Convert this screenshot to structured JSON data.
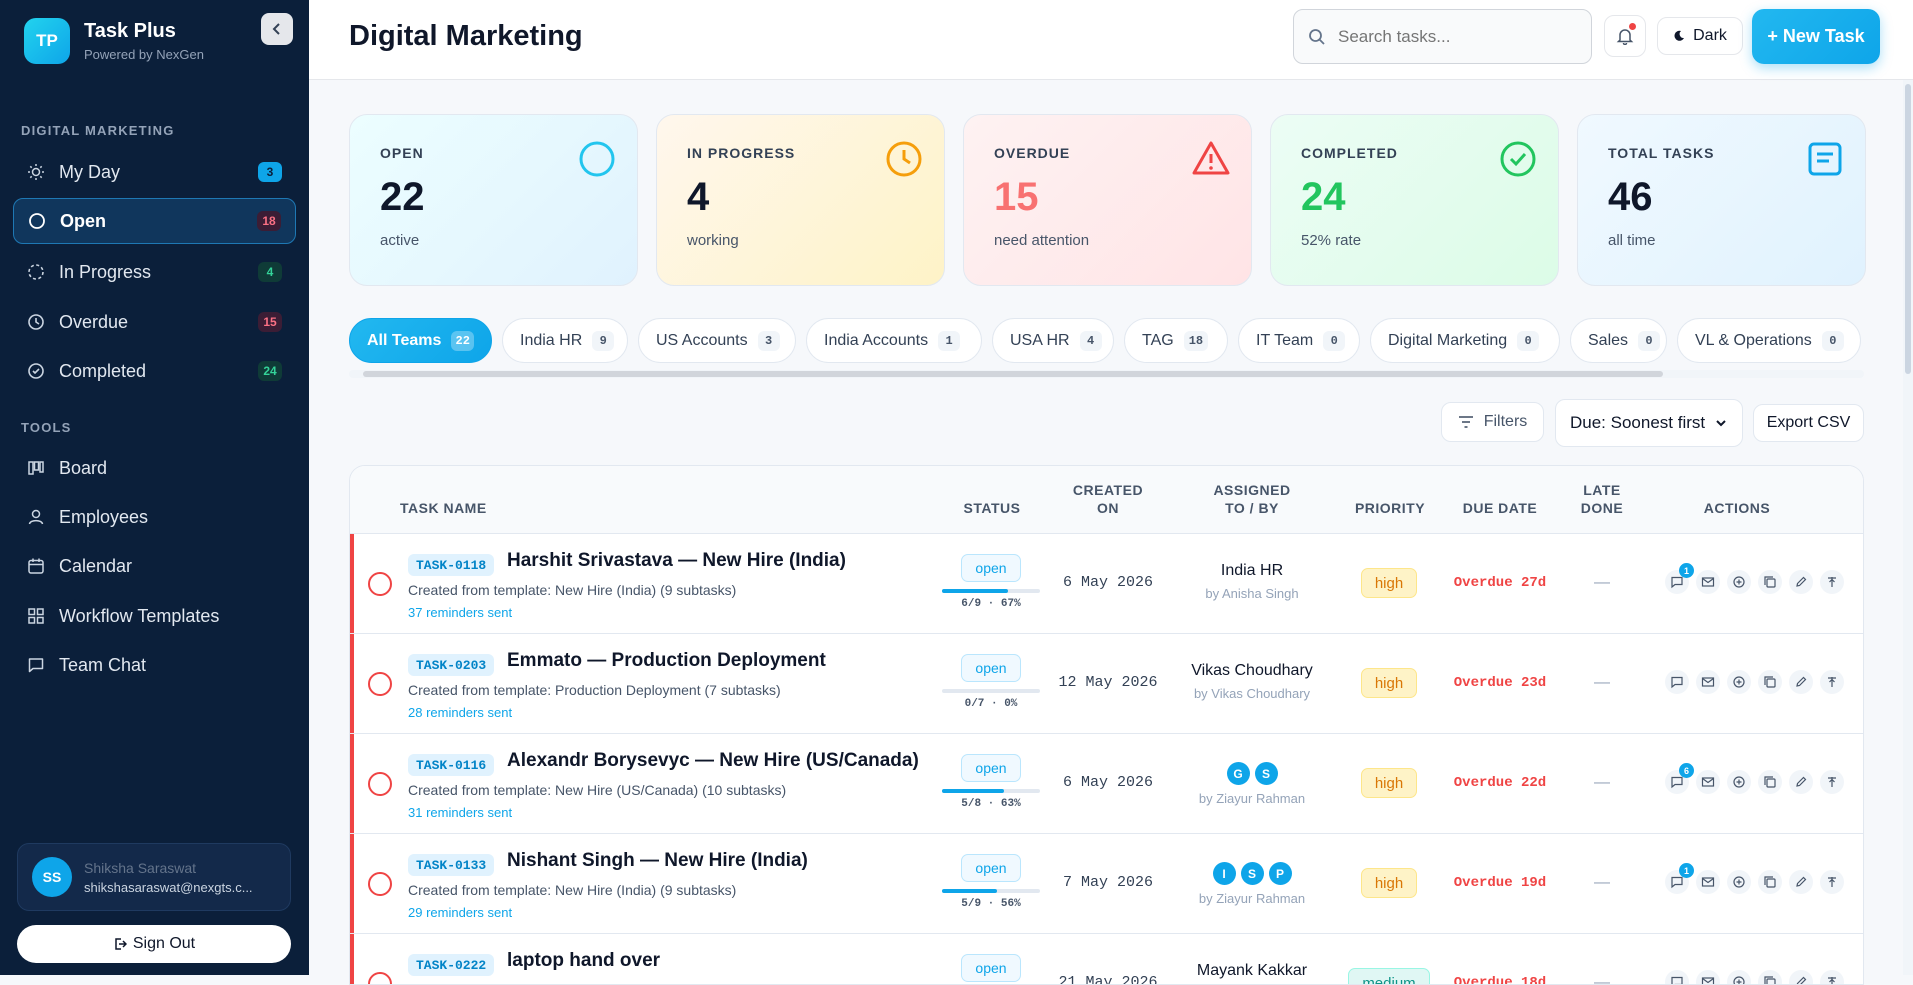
{
  "app": {
    "logo": "TP",
    "name": "Task Plus",
    "tagline": "Powered by NexGen",
    "collapse_icon": "chevron-left-icon"
  },
  "sidebar": {
    "section1": "DIGITAL MARKETING",
    "items": [
      {
        "label": "My Day",
        "count": "3",
        "icon": "sun-icon",
        "count_color": "#0ea5e9"
      },
      {
        "label": "Open",
        "count": "18",
        "icon": "circle-icon",
        "count_color": "#f43f5e"
      },
      {
        "label": "In Progress",
        "count": "4",
        "icon": "dashed-circle-icon",
        "count_color": "#10b981"
      },
      {
        "label": "Overdue",
        "count": "15",
        "icon": "clock-icon",
        "count_color": "#f43f5e"
      },
      {
        "label": "Completed",
        "count": "24",
        "icon": "check-circle-icon",
        "count_color": "#10b981"
      }
    ],
    "section2": "TOOLS",
    "tools": [
      {
        "label": "Board",
        "icon": "board-icon"
      },
      {
        "label": "Employees",
        "icon": "user-icon"
      },
      {
        "label": "Calendar",
        "icon": "calendar-icon"
      },
      {
        "label": "Workflow Templates",
        "icon": "grid-icon"
      },
      {
        "label": "Team Chat",
        "icon": "chat-icon"
      }
    ],
    "user": {
      "initials": "SS",
      "name": "Shiksha Saraswat",
      "email": "shikshasaraswat@nexgts.c..."
    },
    "signout": "Sign Out"
  },
  "header": {
    "title": "Digital Marketing",
    "search_placeholder": "Search tasks...",
    "theme_label": "Dark",
    "new_task_label": "+ New Task"
  },
  "stats": [
    {
      "label": "OPEN",
      "value": "22",
      "sub": "active",
      "color": "#0f172a"
    },
    {
      "label": "IN PROGRESS",
      "value": "4",
      "sub": "working",
      "color": "#0f172a"
    },
    {
      "label": "OVERDUE",
      "value": "15",
      "sub": "need attention",
      "color": "#f87171"
    },
    {
      "label": "COMPLETED",
      "value": "24",
      "sub": "52% rate",
      "color": "#22c55e"
    },
    {
      "label": "TOTAL TASKS",
      "value": "46",
      "sub": "all time",
      "color": "#0f172a"
    }
  ],
  "teams": [
    {
      "label": "All Teams",
      "count": "22"
    },
    {
      "label": "India HR",
      "count": "9"
    },
    {
      "label": "US Accounts",
      "count": "3"
    },
    {
      "label": "India Accounts",
      "count": "1"
    },
    {
      "label": "USA HR",
      "count": "4"
    },
    {
      "label": "TAG",
      "count": "18"
    },
    {
      "label": "IT Team",
      "count": "0"
    },
    {
      "label": "Digital Marketing",
      "count": "0"
    },
    {
      "label": "Sales",
      "count": "0"
    },
    {
      "label": "VL & Operations",
      "count": "0"
    }
  ],
  "toolbar": {
    "filters": "Filters",
    "sort": "Due: Soonest first",
    "export": "Export CSV"
  },
  "columns": {
    "task": "TASK NAME",
    "status": "STATUS",
    "created1": "CREATED",
    "created2": "ON",
    "assigned1": "ASSIGNED",
    "assigned2": "TO / BY",
    "priority": "PRIORITY",
    "due": "DUE DATE",
    "late1": "LATE",
    "late2": "DONE",
    "actions": "ACTIONS"
  },
  "tasks": [
    {
      "id": "TASK-0118",
      "name": "Harshit Srivastava — New Hire (India)",
      "desc": "Created from template: New Hire (India) (9 subtasks)",
      "reminders": "37 reminders sent",
      "status": "open",
      "progress": 0.67,
      "progress_label": "6/9 · 67%",
      "created": "6 May 2026",
      "assigned_to": "India HR",
      "assigned_by": "by Anisha Singh",
      "chips": [],
      "priority": "high",
      "due": "Overdue 27d",
      "late": "—",
      "comments": "1"
    },
    {
      "id": "TASK-0203",
      "name": "Emmato — Production Deployment",
      "desc": "Created from template: Production Deployment (7 subtasks)",
      "reminders": "28 reminders sent",
      "status": "open",
      "progress": 0,
      "progress_label": "0/7 · 0%",
      "created": "12 May 2026",
      "assigned_to": "Vikas Choudhary",
      "assigned_by": "by Vikas Choudhary",
      "chips": [],
      "priority": "high",
      "due": "Overdue 23d",
      "late": "—",
      "comments": ""
    },
    {
      "id": "TASK-0116",
      "name": "Alexandr Borysevyc — New Hire (US/Canada)",
      "desc": "Created from template: New Hire (US/Canada) (10 subtasks)",
      "reminders": "31 reminders sent",
      "status": "open",
      "progress": 0.63,
      "progress_label": "5/8 · 63%",
      "created": "6 May 2026",
      "assigned_to": "",
      "assigned_by": "by Ziayur Rahman",
      "chips": [
        "G",
        "S"
      ],
      "priority": "high",
      "due": "Overdue 22d",
      "late": "—",
      "comments": "6"
    },
    {
      "id": "TASK-0133",
      "name": "Nishant Singh — New Hire (India)",
      "desc": "Created from template: New Hire (India) (9 subtasks)",
      "reminders": "29 reminders sent",
      "status": "open",
      "progress": 0.56,
      "progress_label": "5/9 · 56%",
      "created": "7 May 2026",
      "assigned_to": "",
      "assigned_by": "by Ziayur Rahman",
      "chips": [
        "I",
        "S",
        "P"
      ],
      "priority": "high",
      "due": "Overdue 19d",
      "late": "—",
      "comments": "1"
    },
    {
      "id": "TASK-0222",
      "name": "laptop hand over",
      "desc": "",
      "reminders": "",
      "status": "open",
      "progress": 0,
      "progress_label": "",
      "created": "21 May 2026",
      "assigned_to": "Mayank Kakkar",
      "assigned_by": "",
      "chips": [],
      "priority": "medium",
      "due": "Overdue 18d",
      "late": "—",
      "comments": ""
    }
  ]
}
